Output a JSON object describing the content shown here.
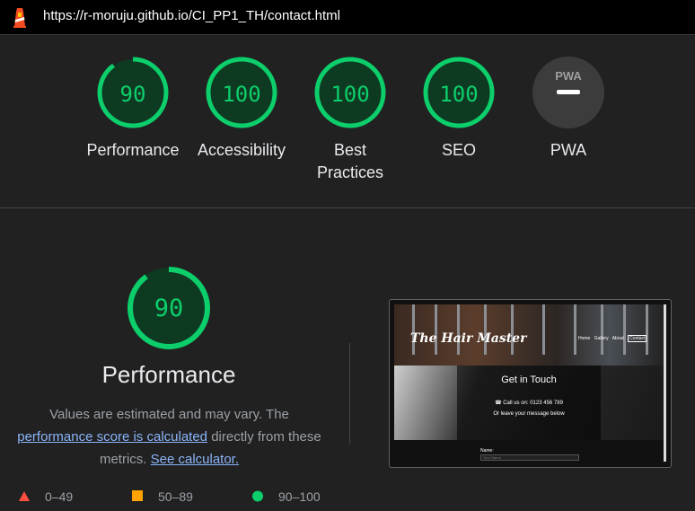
{
  "header": {
    "url": "https://r-moruju.github.io/CI_PP1_TH/contact.html",
    "icon": "lighthouse-icon"
  },
  "gauges": [
    {
      "label": "Performance",
      "score": "90",
      "fraction": 0.9
    },
    {
      "label": "Accessibility",
      "score": "100",
      "fraction": 1.0
    },
    {
      "label": "Best Practices",
      "score": "100",
      "fraction": 1.0
    },
    {
      "label": "SEO",
      "score": "100",
      "fraction": 1.0
    },
    {
      "label": "PWA",
      "badge_text": "PWA",
      "score": ""
    }
  ],
  "performance": {
    "score": "90",
    "fraction": 0.9,
    "title": "Performance",
    "desc_part1": "Values are estimated and may vary. The",
    "link_score": "performance score is calculated",
    "desc_part2": "directly from these metrics.",
    "link_calc": "See calculator."
  },
  "legend": [
    {
      "range": "0–49",
      "marker": "red-triangle-icon",
      "color": "#ff4e42"
    },
    {
      "range": "50–89",
      "marker": "orange-square-icon",
      "color": "#ffa400"
    },
    {
      "range": "90–100",
      "marker": "green-circle-icon",
      "color": "#0cce6b"
    }
  ],
  "screenshot": {
    "brand": "The Hair Master",
    "nav": [
      "Home",
      "Gallery",
      "About",
      "Contact"
    ],
    "heading": "Get in Touch",
    "phone": "☎ Call us on: 0123 456 789",
    "leave": "Or leave your message below",
    "name_label": "Name:",
    "name_placeholder": "Your Name"
  },
  "colors": {
    "pass": "#0cce6b",
    "pass_bg": "#0e3a22",
    "link": "#8ab4f8",
    "background": "#212121"
  }
}
